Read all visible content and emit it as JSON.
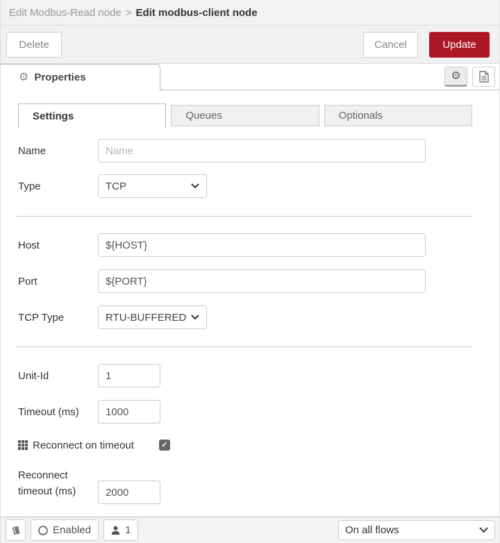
{
  "breadcrumb": {
    "parent": "Edit Modbus-Read node",
    "separator": ">",
    "current": "Edit modbus-client node"
  },
  "toolbar": {
    "delete_label": "Delete",
    "cancel_label": "Cancel",
    "update_label": "Update"
  },
  "panel": {
    "properties_label": "Properties"
  },
  "tabs": [
    {
      "label": "Settings",
      "active": true
    },
    {
      "label": "Queues",
      "active": false
    },
    {
      "label": "Optionals",
      "active": false
    }
  ],
  "form": {
    "name": {
      "label": "Name",
      "placeholder": "Name",
      "value": ""
    },
    "type": {
      "label": "Type",
      "value": "TCP"
    },
    "host": {
      "label": "Host",
      "value": "${HOST}"
    },
    "port": {
      "label": "Port",
      "value": "${PORT}"
    },
    "tcp_type": {
      "label": "TCP Type",
      "value": "RTU-BUFFERED"
    },
    "unit_id": {
      "label": "Unit-Id",
      "value": "1"
    },
    "timeout": {
      "label": "Timeout (ms)",
      "value": "1000"
    },
    "reconnect_on_timeout": {
      "label": "Reconnect on timeout",
      "checked": true,
      "checkmark": "✓"
    },
    "reconnect_timeout": {
      "label_line1": "Reconnect",
      "label_line2": "timeout (ms)",
      "value": "2000"
    }
  },
  "icons": {
    "gear": "⚙"
  },
  "footer": {
    "enabled_label": "Enabled",
    "user_count": "1",
    "scope_selected": "On all flows"
  },
  "colors": {
    "accent_red": "#AD1625",
    "header_gray": "#f2f2f2",
    "border_gray": "#cccccc",
    "footer_gray": "#f3f3f3"
  }
}
